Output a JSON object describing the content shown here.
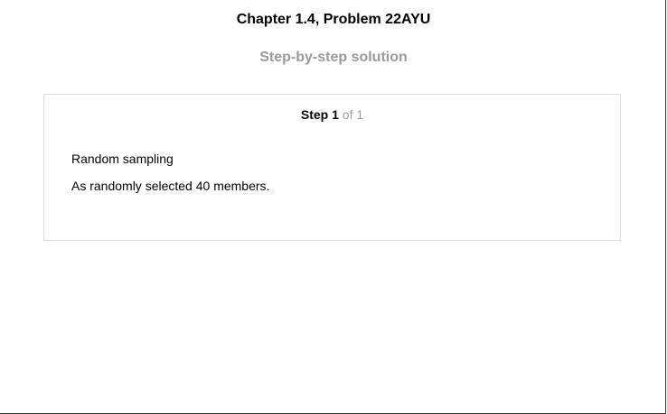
{
  "header": {
    "title": "Chapter 1.4, Problem 22AYU",
    "subtitle": "Step-by-step solution"
  },
  "step": {
    "word": "Step",
    "number": "1",
    "of_text": "of 1",
    "lines": [
      "Random sampling",
      "As randomly selected 40 members."
    ]
  },
  "colors": {
    "muted_text": "#9a9a9a",
    "card_border": "#dcdcdc"
  }
}
